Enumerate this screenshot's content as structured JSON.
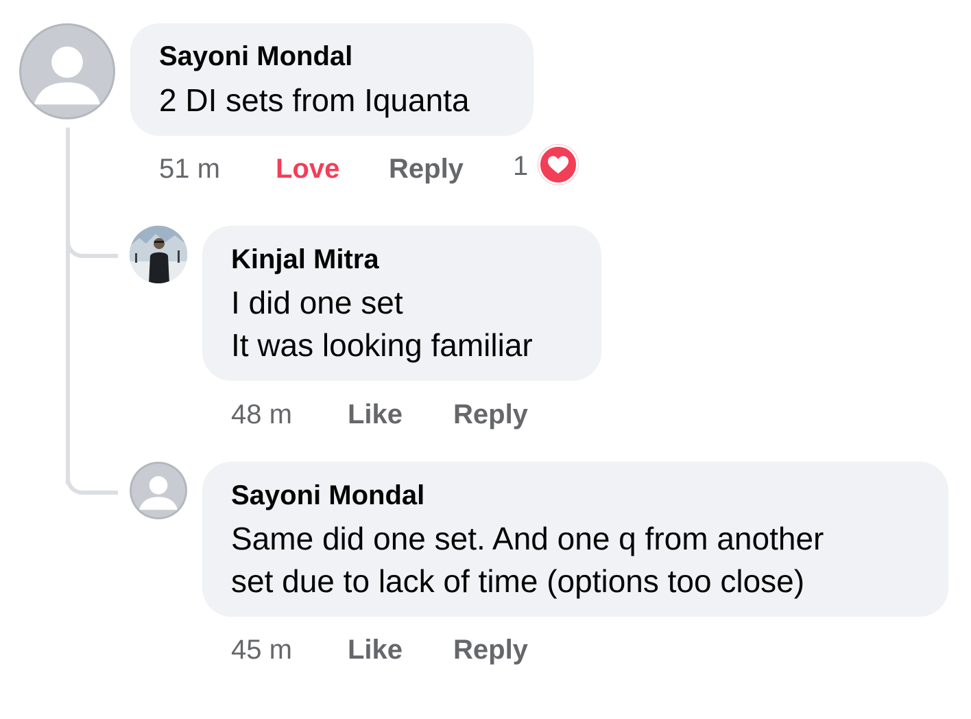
{
  "comments": [
    {
      "author": "Sayoni Mondal",
      "avatar_icon": "default-avatar-icon",
      "text": "2 DI sets from Iquanta",
      "time": "51 m",
      "reaction_label": "Love",
      "reaction_color": "#f33e58",
      "reply_label": "Reply",
      "reaction_count": "1",
      "reaction_icon": "heart-icon"
    },
    {
      "author": "Kinjal Mitra",
      "avatar_icon": "profile-photo",
      "text": "I did one set\nIt was looking familiar",
      "time": "48 m",
      "like_label": "Like",
      "reply_label": "Reply"
    },
    {
      "author": "Sayoni Mondal",
      "avatar_icon": "default-avatar-icon",
      "text": "Same did one set. And one q from another\nset due to lack of time (options too close)",
      "time": "45 m",
      "like_label": "Like",
      "reply_label": "Reply"
    }
  ],
  "colors": {
    "bubble": "#f0f2f5",
    "secondary_text": "#65676b",
    "love": "#f33e58"
  }
}
